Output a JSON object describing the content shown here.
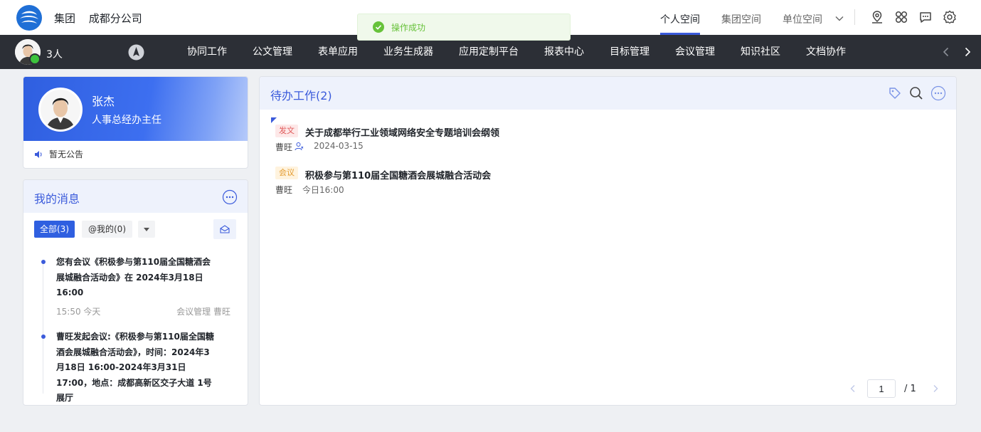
{
  "header": {
    "org_group": "集团",
    "org_branch": "成都分公司",
    "space_tabs": [
      {
        "label": "个人空间",
        "active": true
      },
      {
        "label": "集团空间",
        "active": false
      },
      {
        "label": "单位空间",
        "active": false
      }
    ],
    "icons": [
      "location-icon",
      "apps-icon",
      "chat-icon",
      "settings-icon"
    ]
  },
  "toast": {
    "text": "操作成功",
    "status": "success",
    "color": "#67c23a"
  },
  "navbar": {
    "online_count": "3人",
    "items": [
      "协同工作",
      "公文管理",
      "表单应用",
      "业务生成器",
      "应用定制平台",
      "报表中心",
      "目标管理",
      "会议管理",
      "知识社区",
      "文档协作"
    ],
    "background": "#2c2f36"
  },
  "profile": {
    "name": "张杰",
    "role": "人事总经办主任",
    "notice": "暂无公告"
  },
  "messages": {
    "title": "我的消息",
    "filters": {
      "all": "全部(3)",
      "mine": "@我的(0)"
    },
    "items": [
      {
        "text": "您有会议《积极参与第110届全国糖酒会展城融合活动会》在 2024年3月18日 16:00",
        "time": "15:50 今天",
        "source": "会议管理 曹旺"
      },
      {
        "text": "曹旺发起会议:《积极参与第110届全国糖酒会展城融合活动会》，时间：2024年3月18日 16:00-2024年3月31日 17:00，地点：成都高新区交子大道 1号展厅"
      }
    ]
  },
  "todo": {
    "title": "待办工作(2)",
    "items": [
      {
        "tag": "发文",
        "subject": "关于成都举行工业领域网络安全专题培训会纲领",
        "sender": "曹旺",
        "date": "2024-03-15"
      },
      {
        "tag": "会议",
        "subject": "积极参与第110届全国糖酒会展城融合活动会",
        "sender": "曹旺",
        "date": "今日16:00"
      }
    ],
    "pagination": {
      "current": "1",
      "total": "/ 1"
    }
  },
  "colors": {
    "accent": "#3b5bdb",
    "brand_blue": "#2f5fe0"
  }
}
